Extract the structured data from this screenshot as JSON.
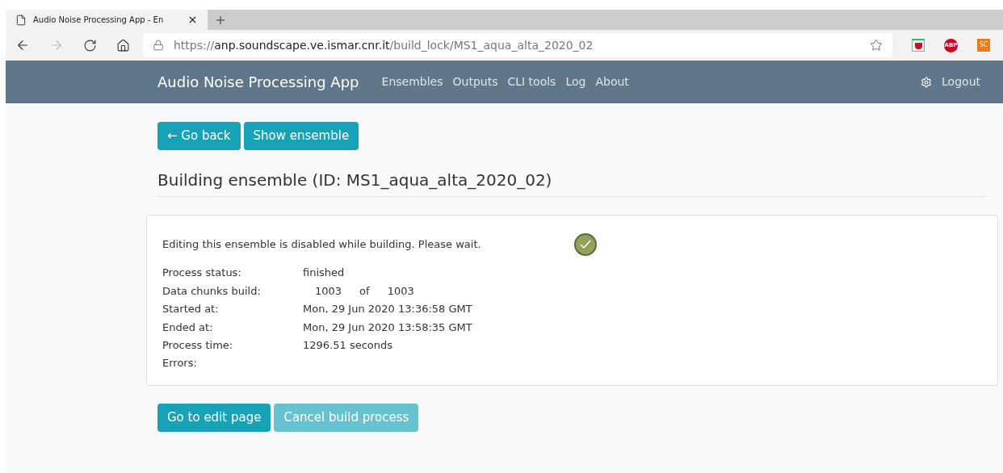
{
  "browser": {
    "tab": {
      "title": "Audio Noise Processing App - En",
      "selected": true
    },
    "url": {
      "scheme": "https://",
      "host": "anp.soundscape.ve.ismar.cnr.it",
      "path": "/build_lock/MS1_aqua_alta_2020_02"
    },
    "extensions": [
      {
        "kind": "shield"
      },
      {
        "kind": "stop",
        "label": "ABP",
        "color": "#d0021b"
      },
      {
        "kind": "square",
        "label": "SC",
        "color": "#f07a1a"
      }
    ]
  },
  "navbar": {
    "brand": "Audio Noise Processing App",
    "links": [
      "Ensembles",
      "Outputs",
      "CLI tools",
      "Log",
      "About"
    ],
    "logout": "Logout"
  },
  "top_buttons": [
    {
      "label": "← Go back",
      "disabled": false
    },
    {
      "label": "Show ensemble",
      "disabled": false
    }
  ],
  "heading": "Building ensemble (ID: MS1_aqua_alta_2020_02)",
  "panel": {
    "message": "Editing this ensemble is disabled while building. Please wait.",
    "done": true,
    "fields": [
      {
        "label": "Process status:",
        "values": [
          "finished"
        ]
      },
      {
        "label": "Data chunks build:",
        "values": [
          "1003",
          "of",
          "1003"
        ]
      },
      {
        "label": "Started at:",
        "values": [
          "Mon, 29 Jun 2020 13:36:58 GMT"
        ]
      },
      {
        "label": "Ended at:",
        "values": [
          "Mon, 29 Jun 2020 13:58:35 GMT"
        ]
      },
      {
        "label": "Process time:",
        "values": [
          "1296.51 seconds"
        ]
      },
      {
        "label": "Errors:"
      }
    ]
  },
  "bottom_buttons": [
    {
      "label": "Go to edit page",
      "disabled": false
    },
    {
      "label": "Cancel build process",
      "disabled": true
    }
  ]
}
